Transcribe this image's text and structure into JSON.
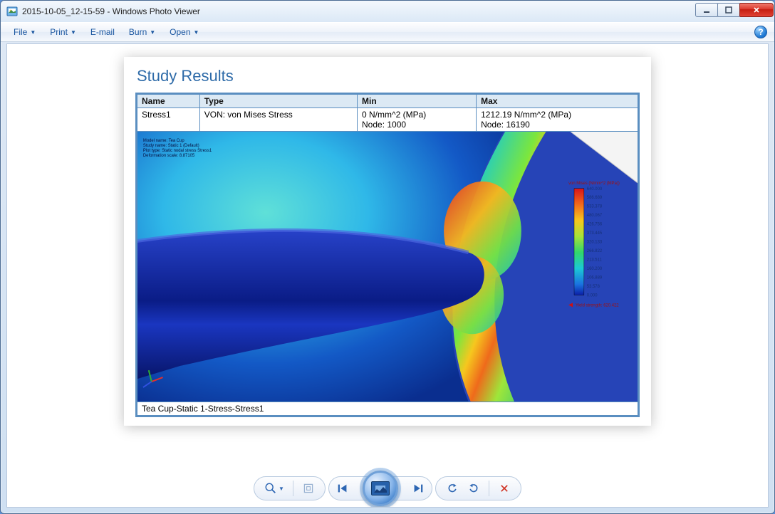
{
  "window": {
    "title": "2015-10-05_12-15-59 - Windows Photo Viewer"
  },
  "menu": {
    "file": "File",
    "print": "Print",
    "email": "E-mail",
    "burn": "Burn",
    "open": "Open",
    "help_tooltip": "?"
  },
  "report": {
    "heading": "Study Results",
    "columns": {
      "name": "Name",
      "type": "Type",
      "min": "Min",
      "max": "Max"
    },
    "row": {
      "name": "Stress1",
      "type": "VON: von Mises Stress",
      "min_line1": "0 N/mm^2 (MPa)",
      "min_line2": "Node: 1000",
      "max_line1": "1212.19 N/mm^2 (MPa)",
      "max_line2": "Node: 16190"
    },
    "caption": "Tea Cup-Static 1-Stress-Stress1",
    "overlay": {
      "l1": "Model name: Tea Cup",
      "l2": "Study name: Static 1 (Default)",
      "l3": "Plot type: Static nodal stress Stress1",
      "l4": "Deformation scale: 8.87105"
    },
    "legend": {
      "title": "von Mises (N/mm^2 (MPa))",
      "yield": "Yield strength: 620.422",
      "ticks": [
        "640.000",
        "586.689",
        "533.378",
        "480.067",
        "426.756",
        "373.445",
        "320.133",
        "266.822",
        "213.511",
        "160.200",
        "106.889",
        "53.578",
        "0.000"
      ]
    }
  }
}
